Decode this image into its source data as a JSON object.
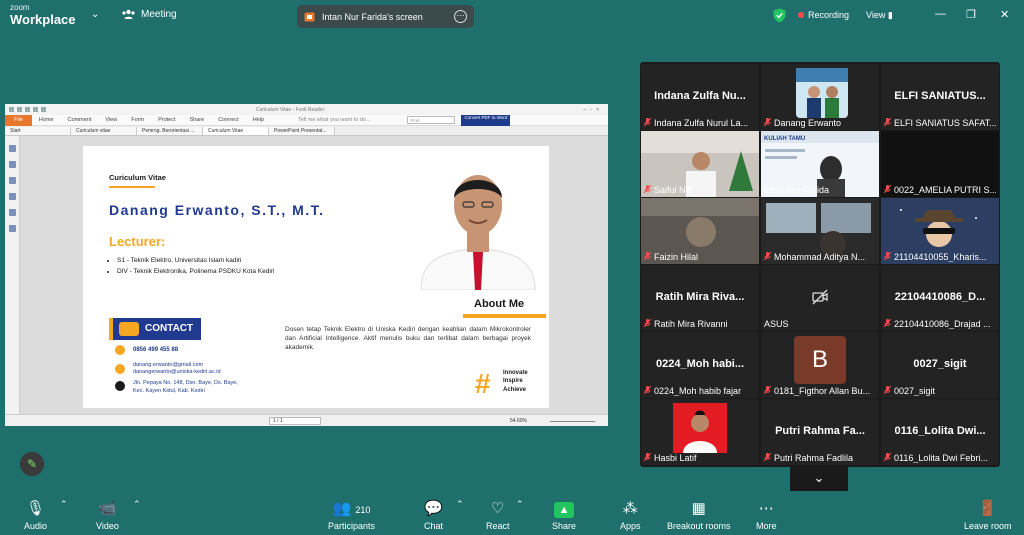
{
  "app": {
    "brand_small": "zoom",
    "brand_large": "Workplace",
    "meeting_label": "Meeting"
  },
  "share": {
    "label": "Intan Nur Farida's screen"
  },
  "status": {
    "recording": "Recording",
    "view": "View"
  },
  "reader": {
    "window_title": "Curiculum Vitae - Foxit Reader",
    "menu": [
      "File",
      "Home",
      "Comment",
      "View",
      "Form",
      "Protect",
      "Share",
      "Connect",
      "Help"
    ],
    "tell_me": "Tell me what you want to do...",
    "find_placeholder": "Find",
    "convert_label": "Convert PDF to Word",
    "tabs": [
      "Start",
      "Curiculum vitae",
      "Pemrog. Berorientasi ...",
      "Curiculum Vitae",
      "PowerPoint Presentat..."
    ],
    "page_indicator": "1 / 1",
    "zoom": "54.60%"
  },
  "cv": {
    "heading": "Curiculum Vitae",
    "name": "Danang Erwanto, S.T., M.T.",
    "lecturer": "Lecturer:",
    "education": [
      "S1 - Teknik Elektro, Universitas Islam kadiri",
      "DIV - Teknik Elektronika, Polinema PSDKU Kota Kediri"
    ],
    "about_title": "About Me",
    "about_text": "Dosen tetap Teknik Elektro di Uniska Kediri dengan keahlian dalam Mikrokontroler dan Artificial Intelligence. Aktif menulis buku dan terlibat dalam berbagai proyek akademik.",
    "contact_title": "CONTACT US",
    "phone": "0856 499 455 88",
    "email1": "danang.erwanto@gmail.com",
    "email2": "danangerwanto@uniska-kediri.ac.id",
    "address1": "Jln. Pepaya No. 148, Dsn. Baye, Ds. Baye,",
    "address2": "Kec. Kayen Kidul, Kab. Kediri",
    "motto": [
      "Innovate",
      "Inspire",
      "Achieve"
    ]
  },
  "participants": [
    {
      "big": "Indana Zulfa Nu...",
      "label": "Indana Zulfa Nurul La...",
      "kind": "name"
    },
    {
      "big": "",
      "label": "Danang Erwanto",
      "kind": "photo-group"
    },
    {
      "big": "ELFI SANIATUS...",
      "label": "ELFI SANIATUS SAFAT...",
      "kind": "name"
    },
    {
      "big": "",
      "label": "Saiful NB",
      "kind": "video-room"
    },
    {
      "big": "",
      "label": "Intan Nur Farida",
      "kind": "video-share"
    },
    {
      "big": "",
      "label": "0022_AMELIA PUTRI S...",
      "kind": "dark"
    },
    {
      "big": "",
      "label": "Faizin Hilal",
      "kind": "video-dark"
    },
    {
      "big": "",
      "label": "Mohammad Aditya N...",
      "kind": "video-bus"
    },
    {
      "big": "",
      "label": "21104410055_Kharis...",
      "kind": "avatar"
    },
    {
      "big": "Ratih Mira Riva...",
      "label": "Ratih Mira Rivanni",
      "kind": "name"
    },
    {
      "big": "",
      "label": "ASUS",
      "kind": "camoff"
    },
    {
      "big": "22104410086_D...",
      "label": "22104410086_Drajad ...",
      "kind": "name"
    },
    {
      "big": "0224_Moh habi...",
      "label": "0224_Moh habib fajar",
      "kind": "name"
    },
    {
      "big": "B",
      "label": "0181_Figthor Allan Bu...",
      "kind": "letter"
    },
    {
      "big": "0027_sigit",
      "label": "0027_sigit",
      "kind": "name"
    },
    {
      "big": "",
      "label": "Hasbi Latif",
      "kind": "photo-red"
    },
    {
      "big": "Putri Rahma Fa...",
      "label": "Putri Rahma Fadlila",
      "kind": "name"
    },
    {
      "big": "0116_Lolita Dwi...",
      "label": "0116_Lolita Dwi Febri...",
      "kind": "name"
    }
  ],
  "toolbar": {
    "audio": "Audio",
    "video": "Video",
    "participants": "Participants",
    "participants_count": "210",
    "chat": "Chat",
    "react": "React",
    "share": "Share",
    "apps": "Apps",
    "breakout": "Breakout rooms",
    "more": "More",
    "leave": "Leave room"
  },
  "colors": {
    "background": "#1f6f6d",
    "share_green": "#22c55e",
    "cv_blue": "#203a8f",
    "cv_orange": "#f5a623",
    "recording": "#ff4b4b"
  }
}
